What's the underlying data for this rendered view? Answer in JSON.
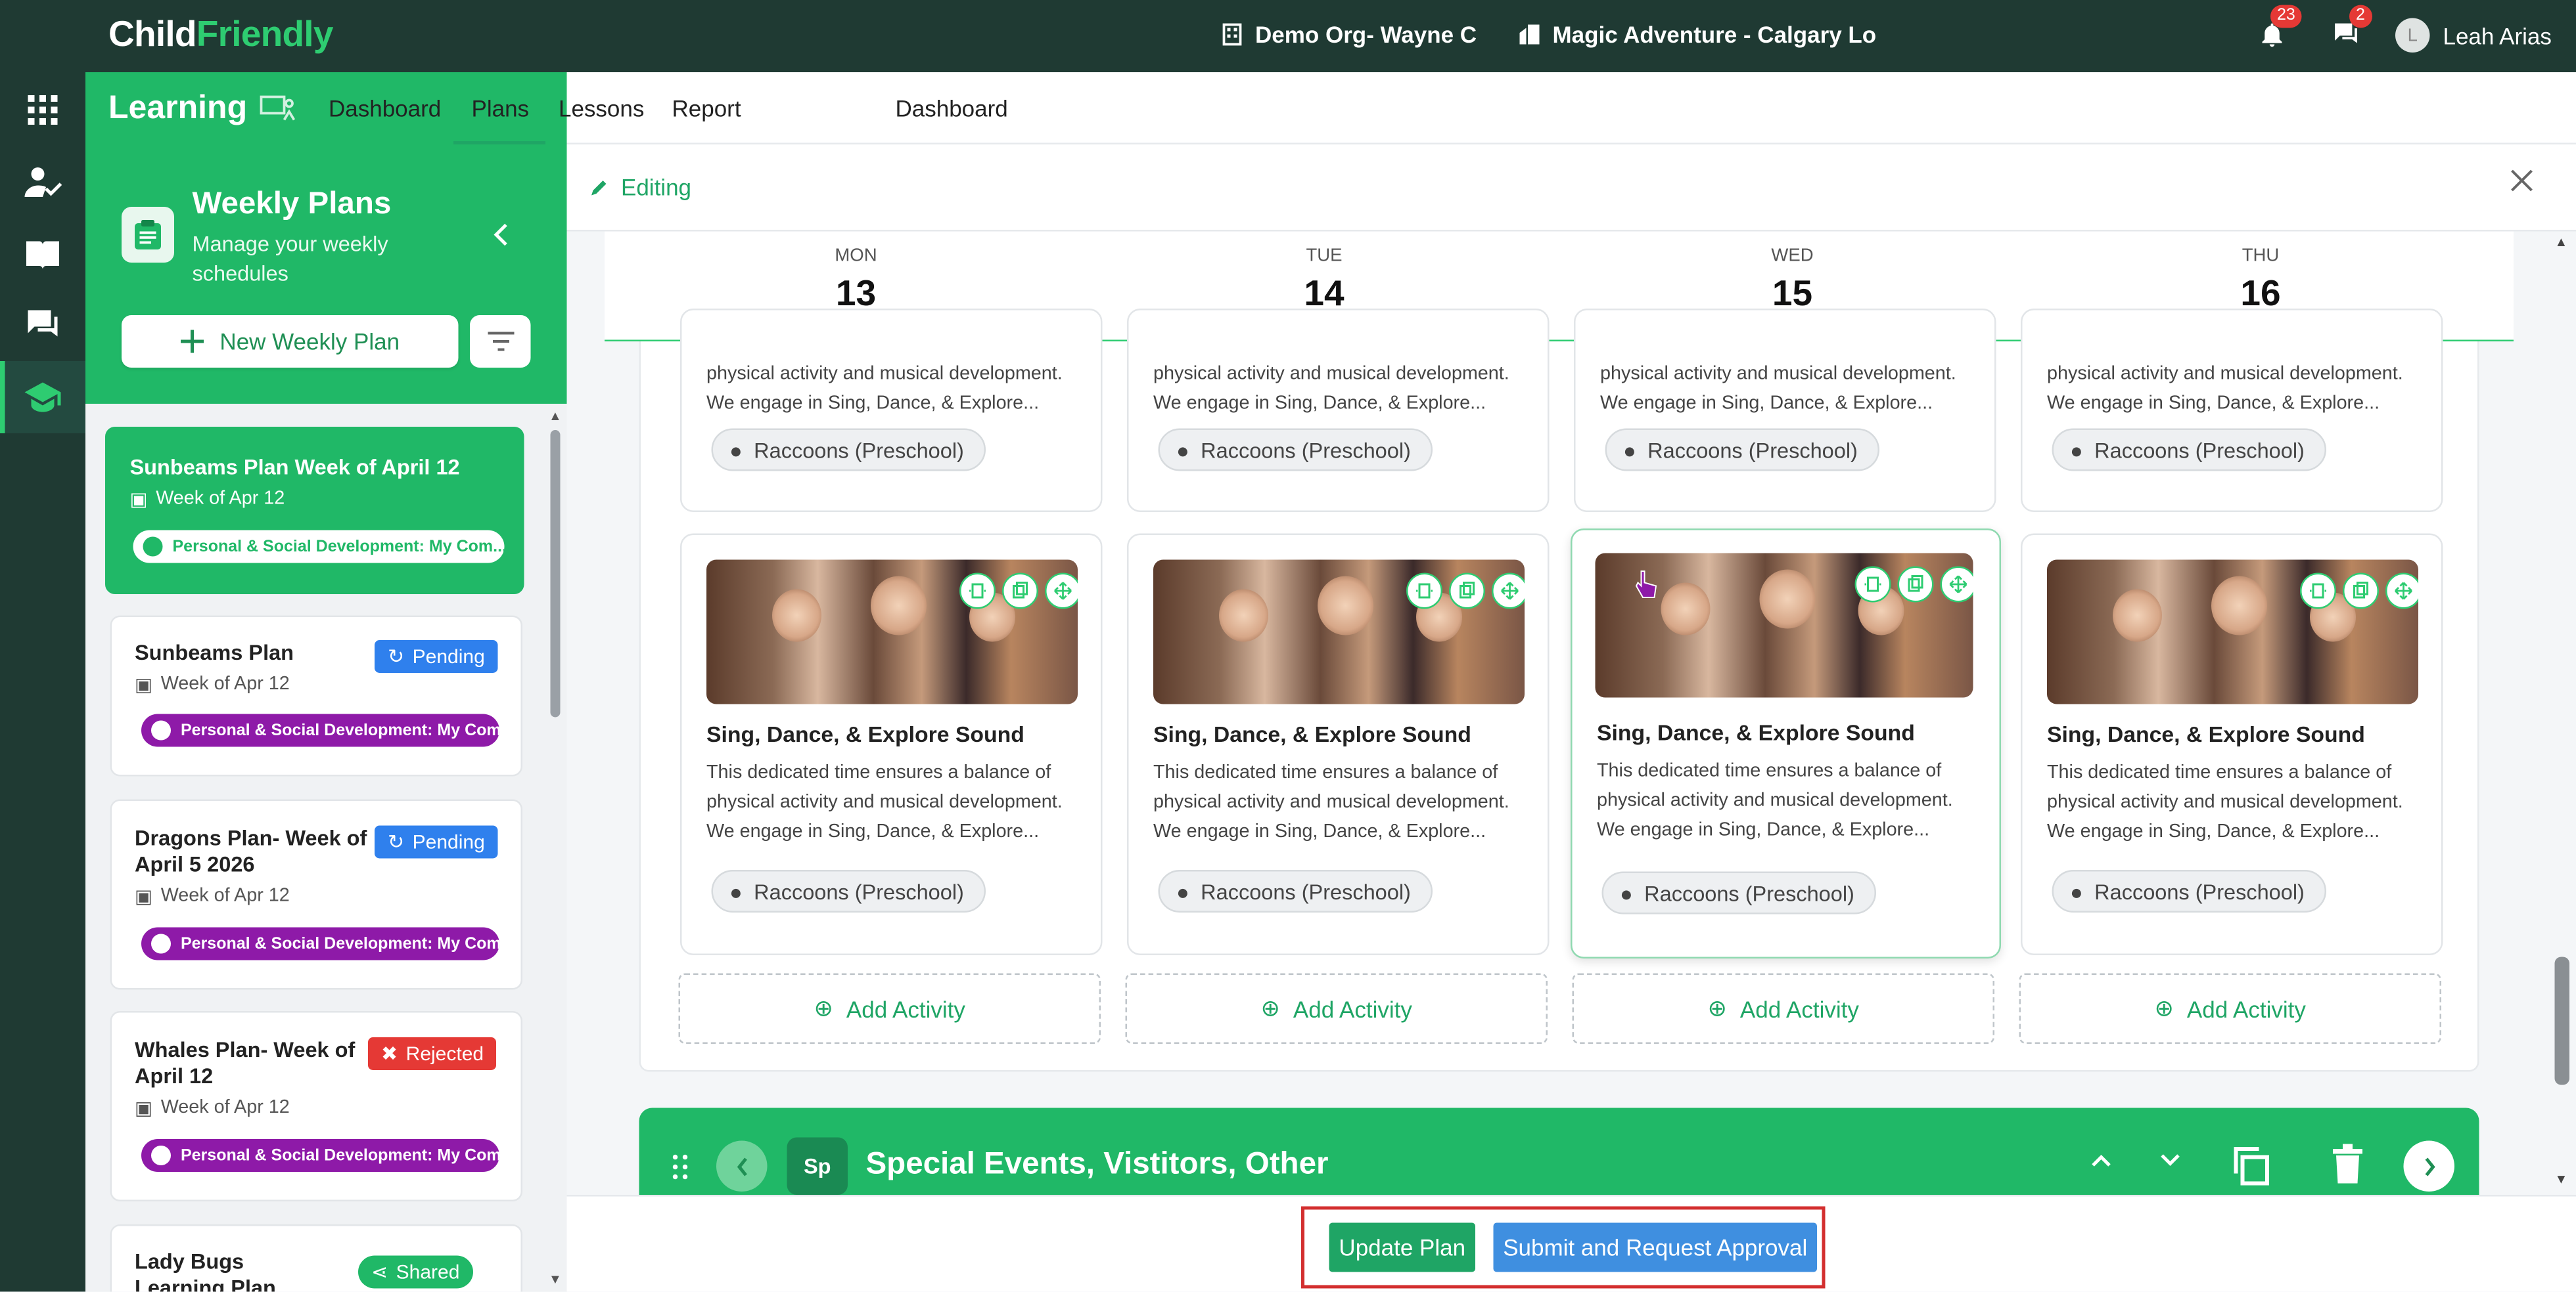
{
  "app": {
    "brand_prefix": "Child",
    "brand_suffix": "Friendly"
  },
  "topbar": {
    "org": "Demo Org- Wayne C",
    "location": "Magic Adventure - Calgary Lo",
    "notifications_count": "23",
    "messages_count": "2",
    "user_initial": "L",
    "user_name": "Leah Arias"
  },
  "module": {
    "title": "Learning"
  },
  "subnav": {
    "items": [
      "Dashboard",
      "Plans",
      "Lessons",
      "Report"
    ],
    "active": "Plans"
  },
  "left_panel": {
    "title": "Weekly Plans",
    "subtitle": "Manage your weekly schedules",
    "new_button": "New Weekly Plan",
    "plans": [
      {
        "title": "Sunbeams Plan Week of April 12",
        "week": "Week of Apr 12",
        "tag": "Personal & Social Development: My Com...",
        "status": ""
      },
      {
        "title": "Sunbeams Plan",
        "week": "Week of Apr 12",
        "tag": "Personal & Social Development: My Com...",
        "status": "Pending"
      },
      {
        "title": "Dragons Plan- Week of April 5 2026",
        "week": "Week of Apr 12",
        "tag": "Personal & Social Development: My Com...",
        "status": "Pending"
      },
      {
        "title": "Whales Plan- Week of April 12",
        "week": "Week of Apr 12",
        "tag": "Personal & Social Development: My Com...",
        "status": "Rejected"
      },
      {
        "title": "Lady Bugs Learning Plan",
        "week": "",
        "tag": "",
        "status": "Shared"
      }
    ]
  },
  "editor": {
    "mode_label": "Editing"
  },
  "days": [
    {
      "name": "MON",
      "date": "13"
    },
    {
      "name": "TUE",
      "date": "14"
    },
    {
      "name": "WED",
      "date": "15"
    },
    {
      "name": "THU",
      "date": "16"
    }
  ],
  "activities_partial": {
    "desc_line1": "physical activity and musical development.",
    "desc_line2": "We engage in Sing, Dance, & Explore...",
    "location": "Raccoons (Preschool)"
  },
  "activity": {
    "title": "Sing, Dance, & Explore Sound",
    "description": "This dedicated time ensures a balance of physical activity and musical development. We engage in Sing, Dance, & Explore...",
    "location": "Raccoons (Preschool)"
  },
  "add_activity_label": "Add Activity",
  "special_section": {
    "badge": "Sp",
    "title": "Special Events, Vistitors, Other"
  },
  "footer": {
    "update_button": "Update Plan",
    "submit_button": "Submit and Request Approval"
  },
  "colors": {
    "brand_green": "#20b867",
    "dark_teal": "#1f3a33",
    "pending_blue": "#2f80ed",
    "rejected_red": "#e53935",
    "tag_purple": "#8e1aa8"
  }
}
